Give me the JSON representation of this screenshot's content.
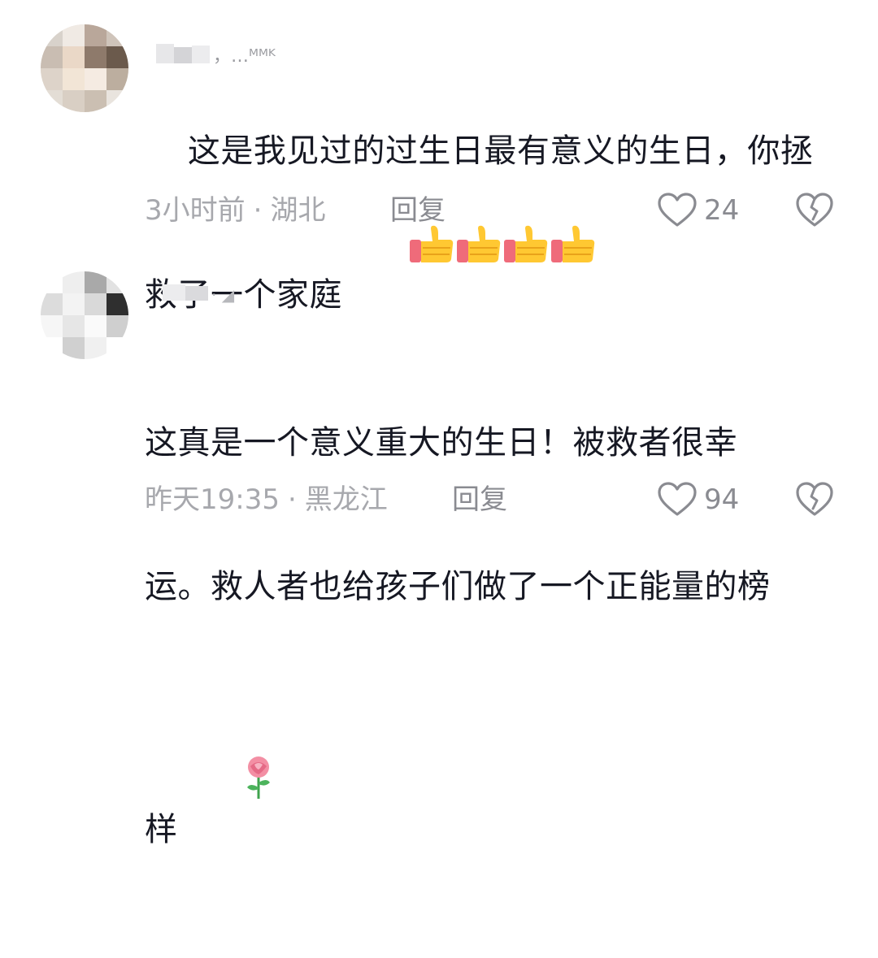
{
  "comments": [
    {
      "username": "，…ᴹᴹᴷ",
      "text": "这是我见过的过生日最有意义的生日，你拯救了一个家庭",
      "emoji": "thumbs-up x4",
      "time": "3小时前",
      "location": "湖北",
      "reply_label": "回复",
      "like_count": "24"
    },
    {
      "username": "·  ◢",
      "text_line1": "这真是一个意义重大的生日！被救者很幸",
      "text_line2": "运。救人者也给孩子们做了一个正能量的榜",
      "text_line3": "样",
      "emoji": "rose",
      "time": "昨天19:35",
      "location": "黑龙江",
      "reply_label": "回复",
      "like_count": "94"
    }
  ],
  "separator": "·",
  "icons": {
    "like": "heart-outline-icon",
    "dislike": "broken-heart-icon",
    "thumbs": "thumbs-up-emoji",
    "rose": "rose-emoji"
  },
  "colors": {
    "text": "#161823",
    "meta": "#a7a8ad",
    "action": "#8a8b91"
  }
}
